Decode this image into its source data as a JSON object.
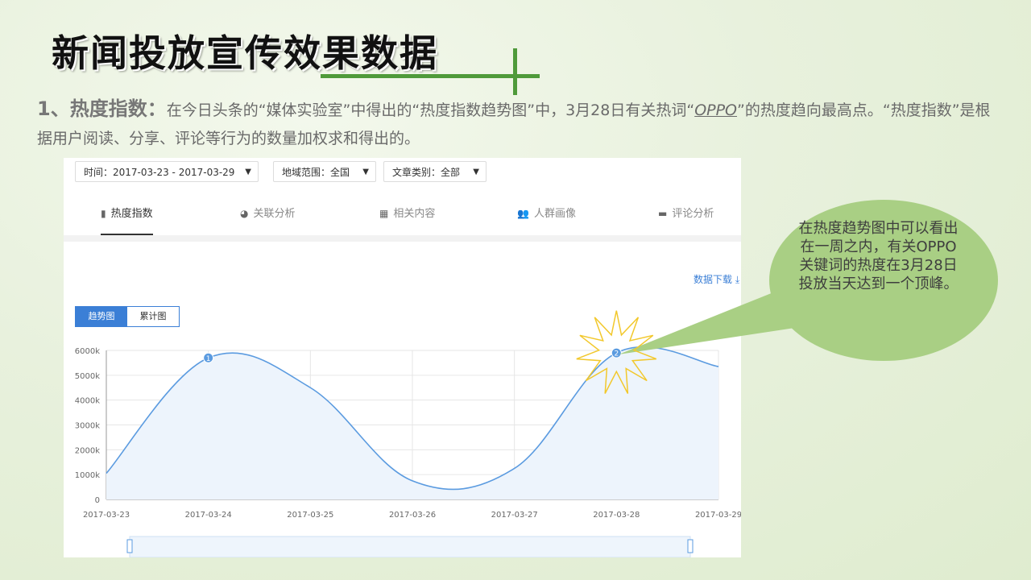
{
  "slide": {
    "title": "新闻投放宣传效果数据",
    "intro_lead": "1、热度指数：",
    "intro_part1": "在今日头条的“媒体实验室”中得出的“热度指数趋势图”中，3月28日有关热词“",
    "intro_keyword": "OPPO",
    "intro_part2": "”的热度趋向最高点。“热度指数”是根据用户阅读、分享、评论等行为的数量加权求和得出的。"
  },
  "filters": [
    {
      "label": "时间：2017-03-23 - 2017-03-29"
    },
    {
      "label": "地域范围：全国"
    },
    {
      "label": "文章类别：全部"
    }
  ],
  "tabs": [
    {
      "label": "热度指数",
      "icon": "bar-chart-icon",
      "glyph": "▮"
    },
    {
      "label": "关联分析",
      "icon": "pie-chart-icon",
      "glyph": "◕"
    },
    {
      "label": "相关内容",
      "icon": "grid-icon",
      "glyph": "▦"
    },
    {
      "label": "人群画像",
      "icon": "users-icon",
      "glyph": "👥"
    },
    {
      "label": "评论分析",
      "icon": "comment-icon",
      "glyph": "▬"
    }
  ],
  "download_label": "数据下载 ⤓",
  "toggle": {
    "trend": "趋势图",
    "cumulative": "累计图"
  },
  "callout": "在热度趋势图中可以看出在一周之内，有关OPPO关键词的热度在3月28日投放当天达到一个顶峰。",
  "colors": {
    "line": "#5b9be0",
    "area": "#edf4fc",
    "accent": "#3b7fd6",
    "bubble": "#a9cf84",
    "star": "#f2c82c"
  },
  "chart_data": {
    "type": "area",
    "x": [
      "2017-03-23",
      "2017-03-24",
      "2017-03-25",
      "2017-03-26",
      "2017-03-27",
      "2017-03-28",
      "2017-03-29"
    ],
    "values": [
      1050000,
      5700000,
      4500000,
      750000,
      1250000,
      5900000,
      5350000
    ],
    "markers": [
      {
        "label": "1",
        "index": 1
      },
      {
        "label": "2",
        "index": 5
      }
    ],
    "yticks": [
      "0",
      "1000k",
      "2000k",
      "3000k",
      "4000k",
      "5000k",
      "6000k"
    ],
    "ylim": [
      0,
      6000000
    ],
    "grid": true
  }
}
